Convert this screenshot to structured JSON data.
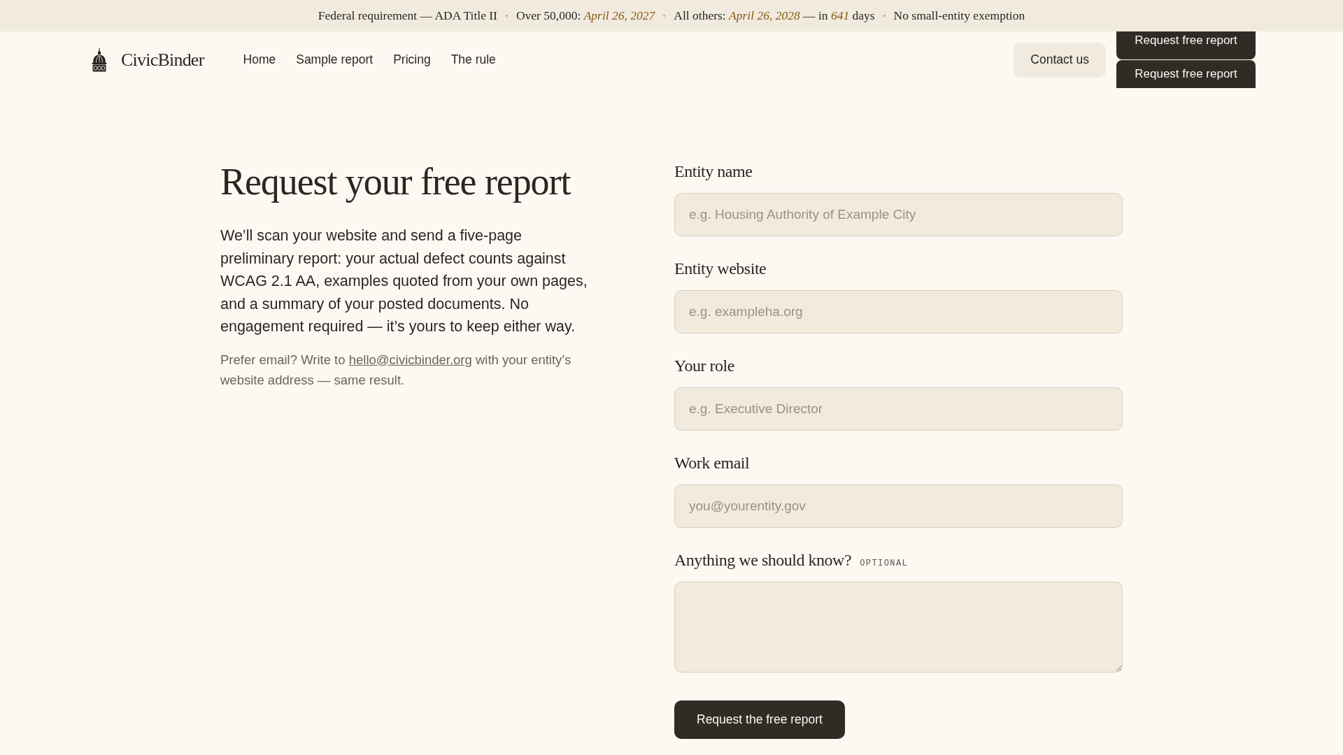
{
  "banner": {
    "items": [
      "Federal requirement — ADA Title II",
      "Over 50,000: *April 26, 2027*",
      "All others: *April 26, 2028* — in *641* days",
      "No small-entity exemption"
    ]
  },
  "header": {
    "brand": "CivicBinder",
    "nav": [
      "Home",
      "Sample report",
      "Pricing",
      "The rule"
    ],
    "contact_button": "Contact us",
    "request_buttons": [
      "Request free report",
      "Request free report"
    ]
  },
  "intro": {
    "title": "Request your free report",
    "paragraph": "We’ll scan your website and send a five-page preliminary report: your actual defect counts against WCAG 2.1 AA, examples quoted from your own pages, and a summary of your posted documents. No engagement required — it’s yours to keep either way.",
    "email_note": {
      "before": "Prefer email? Write to",
      "link": "hello@civicbinder.org",
      "after": "with your entity’s website address — same result."
    }
  },
  "form": {
    "fields": [
      {
        "kind": "input",
        "label": "Entity name",
        "placeholder": "e.g. Housing Authority of Example City"
      },
      {
        "kind": "input",
        "label": "Entity website",
        "placeholder": "e.g. exampleha.org"
      },
      {
        "kind": "input",
        "label": "Your role",
        "placeholder": "e.g. Executive Director"
      },
      {
        "kind": "input",
        "label": "Work email",
        "placeholder": "you@yourentity.gov"
      },
      {
        "kind": "textarea",
        "label": "Anything we should know?",
        "tag": "OPTIONAL"
      }
    ],
    "submit": "Request the free report"
  }
}
